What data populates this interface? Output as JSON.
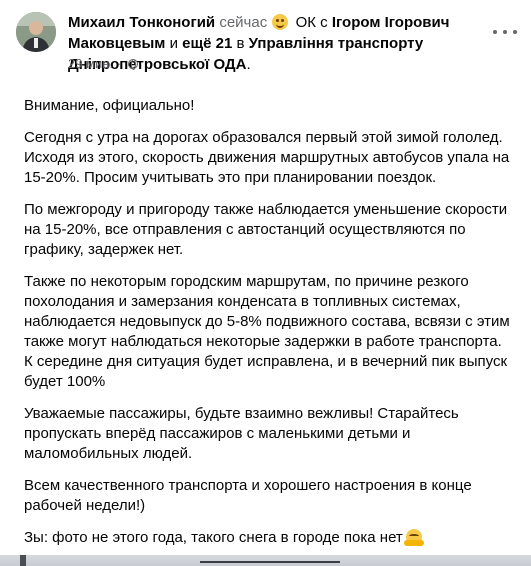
{
  "post": {
    "author": "Михаил Тонконогий",
    "status_word": "сейчас",
    "feeling_icon": "ok-face-emoji",
    "feeling": "ОК",
    "with_prefix": "с",
    "tagged_person": "Ігором Ігорович Маковцевым",
    "and_more_prefix": "и",
    "and_more": "ещё 21",
    "location_prefix": "в",
    "location": "Управління транспорту Дніпропетровської ОДА",
    "location_suffix": ".",
    "time_ago": "29 мин.",
    "audience_icon": "globe-icon",
    "more_icon": "more-horizontal-icon"
  },
  "content": {
    "paragraphs": [
      "Внимание, официально!",
      "Сегодня с утра на дорогах образовался первый этой зимой гололед. Исходя из этого, скорость движения маршрутных автобусов упала на 15-20%. Просим учитывать это при планировании поездок.",
      "По межгороду и пригороду также наблюдается уменьшение скорости на 15-20%, все отправления с автостанций осуществляются по графику, задержек нет.",
      "Также по некоторым городским маршрутам, по причине резкого похолодания и замерзания конденсата в топливных системах, наблюдается недовыпуск до 5-8% подвижного состава, всвязи с этим также могут наблюдаться некоторые задержки в работе транспорта. К середине дня ситуация будет исправлена, и в вечерний пик выпуск будет 100%",
      "Уважаемые пассажиры, будьте взаимно вежливы! Старайтесь пропускать вперёд пассажиров с маленькими детьми и маломобильных людей.",
      "Всем качественного транспорта и хорошего настроения в конце рабочей недели!)",
      "Зы: фото не этого года, такого снега в городе пока нет"
    ],
    "closing_emoji": "hugging-face-emoji"
  }
}
